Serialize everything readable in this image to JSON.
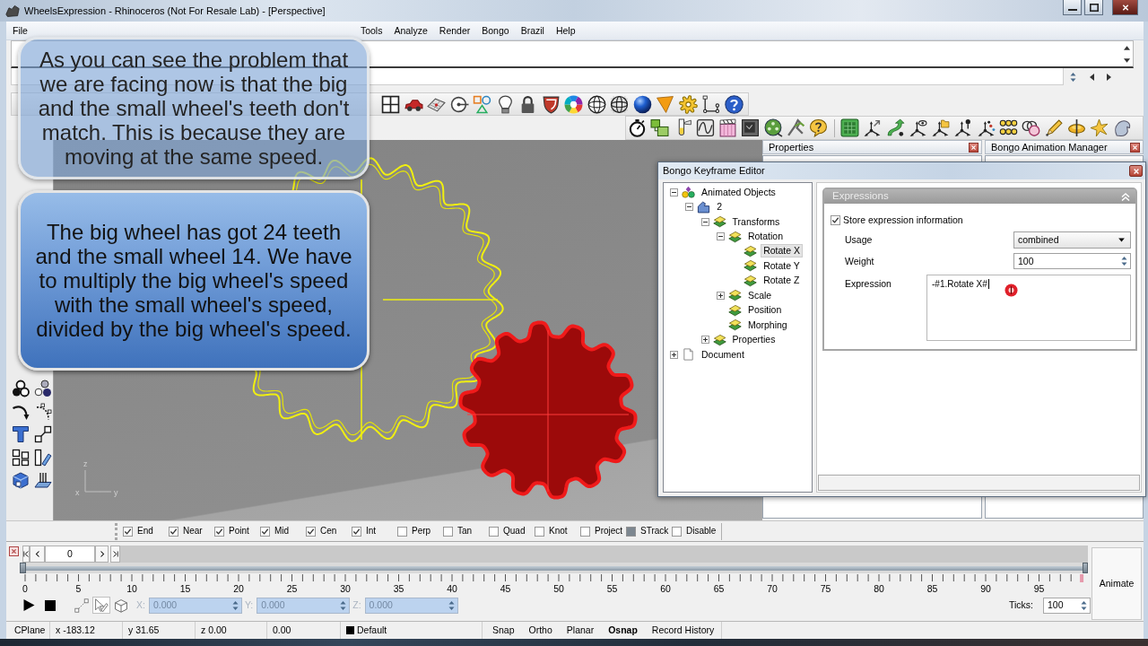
{
  "window": {
    "title": "WheelsExpression - Rhinoceros (Not For Resale Lab) - [Perspective]"
  },
  "menu": [
    "File",
    "Tools",
    "Analyze",
    "Render",
    "Bongo",
    "Brazil",
    "Help"
  ],
  "callouts": [
    {
      "kind": "faded",
      "text": "As you can see the problem that we are facing now is that the big and the small wheel's teeth don't match. This is because they are moving at the same speed."
    },
    {
      "kind": "solid",
      "text": "The big wheel has got 24 teeth and the small wheel 14. We have to multiply the big wheel's speed with the small wheel's speed, divided by the big wheel's speed."
    }
  ],
  "viewport": {
    "axis_labels": [
      "z",
      "x",
      "y"
    ]
  },
  "panels": [
    {
      "title": "Properties"
    },
    {
      "title": "Bongo Animation Manager"
    }
  ],
  "keyframe_editor": {
    "title": "Bongo Keyframe Editor",
    "tree": [
      {
        "label": "Animated Objects",
        "kind": "root",
        "expanded": true,
        "selected": false,
        "children": [
          {
            "label": "2",
            "kind": "object",
            "expanded": true,
            "selected": false,
            "children": [
              {
                "label": "Transforms",
                "kind": "channel",
                "expanded": true,
                "selected": false,
                "children": [
                  {
                    "label": "Rotation",
                    "kind": "channel",
                    "expanded": true,
                    "selected": false,
                    "children": [
                      {
                        "label": "Rotate X",
                        "kind": "channel",
                        "selected": true
                      },
                      {
                        "label": "Rotate Y",
                        "kind": "channel",
                        "selected": false
                      },
                      {
                        "label": "Rotate Z",
                        "kind": "channel",
                        "selected": false
                      }
                    ]
                  },
                  {
                    "label": "Scale",
                    "kind": "channel",
                    "expanded": false,
                    "selected": false
                  },
                  {
                    "label": "Position",
                    "kind": "channel",
                    "selected": false
                  },
                  {
                    "label": "Morphing",
                    "kind": "channel",
                    "selected": false
                  }
                ]
              },
              {
                "label": "Properties",
                "kind": "channel",
                "expanded": false,
                "selected": false
              }
            ]
          }
        ]
      },
      {
        "label": "Document",
        "kind": "document",
        "expanded": false,
        "selected": false
      }
    ],
    "expressions": {
      "title": "Expressions",
      "expanded": true,
      "store_checkbox": {
        "label": "Store expression information",
        "checked": true
      },
      "usage": {
        "label": "Usage",
        "value": "combined"
      },
      "weight": {
        "label": "Weight",
        "value": "100"
      },
      "expression": {
        "label": "Expression",
        "value": "-#1.Rotate X#"
      }
    }
  },
  "osnaps": [
    {
      "label": "End",
      "checked": true,
      "indeterminate": false
    },
    {
      "label": "Near",
      "checked": true,
      "indeterminate": false
    },
    {
      "label": "Point",
      "checked": true,
      "indeterminate": false
    },
    {
      "label": "Mid",
      "checked": true,
      "indeterminate": false
    },
    {
      "label": "Cen",
      "checked": true,
      "indeterminate": false
    },
    {
      "label": "Int",
      "checked": true,
      "indeterminate": false
    },
    {
      "label": "Perp",
      "checked": false,
      "indeterminate": false
    },
    {
      "label": "Tan",
      "checked": false,
      "indeterminate": false
    },
    {
      "label": "Quad",
      "checked": false,
      "indeterminate": false
    },
    {
      "label": "Knot",
      "checked": false,
      "indeterminate": false
    },
    {
      "label": "Project",
      "checked": false,
      "indeterminate": false
    },
    {
      "label": "STrack",
      "checked": false,
      "indeterminate": true
    },
    {
      "label": "Disable",
      "checked": false,
      "indeterminate": false
    }
  ],
  "timeline": {
    "frame": "0",
    "level": 0,
    "tick_labels": [
      "0",
      "5",
      "10",
      "15",
      "20",
      "25",
      "30",
      "35",
      "40",
      "45",
      "50",
      "55",
      "60",
      "65",
      "70",
      "75",
      "80",
      "85",
      "90",
      "95"
    ],
    "transform_modes": [
      {
        "selected": false
      },
      {
        "selected": true
      },
      {
        "selected": false
      }
    ],
    "coordinates": [
      {
        "label": "X:",
        "value": "0.000",
        "disabled": true
      },
      {
        "label": "Y:",
        "value": "0.000",
        "disabled": true
      },
      {
        "label": "Z:",
        "value": "0.000",
        "disabled": true
      }
    ],
    "ticks_label": "Ticks:",
    "ticks_value": "100",
    "animate_button": "Animate"
  },
  "status_bar": {
    "readouts": [
      "CPlane",
      "x -183.12",
      "y 31.65",
      "z 0.00",
      "0.00"
    ],
    "layer": {
      "name": "Default",
      "color": "#000000"
    },
    "toggles": [
      {
        "label": "Snap",
        "on": false
      },
      {
        "label": "Ortho",
        "on": false
      },
      {
        "label": "Planar",
        "on": false
      },
      {
        "label": "Osnap",
        "on": true
      },
      {
        "label": "Record History",
        "on": false
      }
    ]
  }
}
